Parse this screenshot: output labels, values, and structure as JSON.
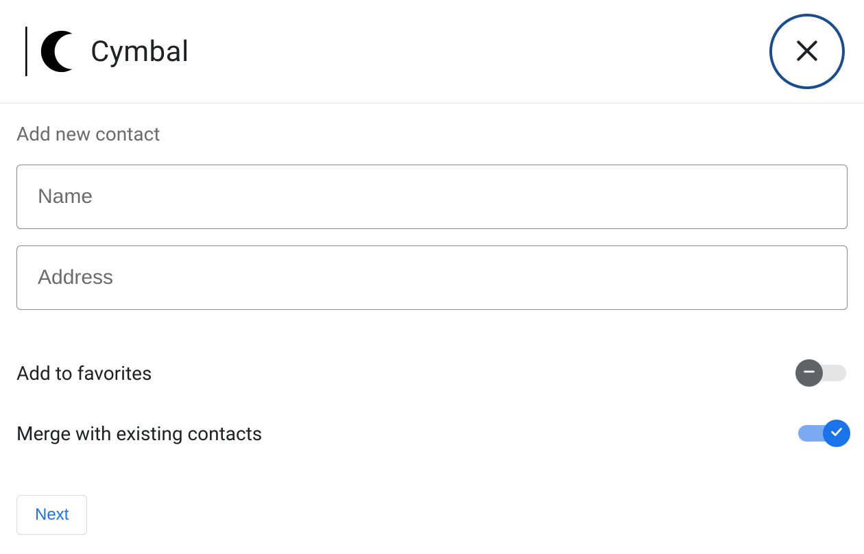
{
  "header": {
    "brand_name": "Cymbal"
  },
  "form": {
    "section_title": "Add new contact",
    "name_placeholder": "Name",
    "name_value": "",
    "address_placeholder": "Address",
    "address_value": "",
    "favorites_label": "Add to favorites",
    "favorites_on": false,
    "merge_label": "Merge with existing contacts",
    "merge_on": true,
    "next_label": "Next"
  },
  "colors": {
    "close_ring": "#1a4d8f",
    "accent": "#1a73e8",
    "accent_light": "#7ba9f2",
    "text_muted": "#6b6b6b",
    "knob_off": "#5f6368"
  }
}
